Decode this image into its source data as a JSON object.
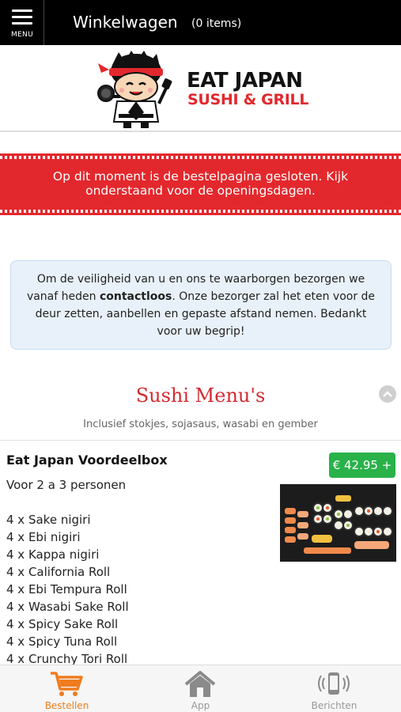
{
  "topbar": {
    "menu_label": "MENU",
    "cart_title": "Winkelwagen",
    "cart_count": "(0 items)"
  },
  "brand": {
    "name": "EAT JAPAN",
    "tagline": "SUSHI & GRILL",
    "accent_color": "#e3282d"
  },
  "notice": {
    "closed_line1": "Op dit moment is de bestelpagina gesloten. Kijk",
    "closed_line2": "onderstaand voor de openingsdagen."
  },
  "info": {
    "text_before": "Om de veiligheid van u en ons te waarborgen bezorgen we vanaf heden ",
    "bold": "contactloos",
    "text_after": ". Onze bezorger zal het eten voor de deur zetten, aanbellen en gepaste afstand nemen. Bedankt voor uw begrip!"
  },
  "section": {
    "title": "Sushi Menu's",
    "subtitle": "Inclusief stokjes, sojasaus, wasabi en gember",
    "collapse_icon": "chevron-up-icon"
  },
  "product": {
    "name": "Eat Japan Voordeelbox",
    "price": "€ 42.95 +",
    "description": "Voor 2 a 3 personen",
    "items": [
      "4 x Sake nigiri",
      "4 x Ebi nigiri",
      "4 x Kappa nigiri",
      "4 x California Roll",
      "4 x Ebi Tempura Roll",
      "4 x Wasabi Sake Roll",
      "4 x Spicy Sake Roll",
      "4 x Spicy Tuna Roll",
      "4 x Crunchy Tori Roll"
    ],
    "price_color": "#29b24a"
  },
  "bottom_nav": {
    "items": [
      {
        "label": "Bestellen",
        "icon": "cart-icon",
        "active": true
      },
      {
        "label": "App",
        "icon": "home-icon",
        "active": false
      },
      {
        "label": "Berichten",
        "icon": "phone-icon",
        "active": false
      }
    ],
    "active_color": "#f07c1e"
  }
}
